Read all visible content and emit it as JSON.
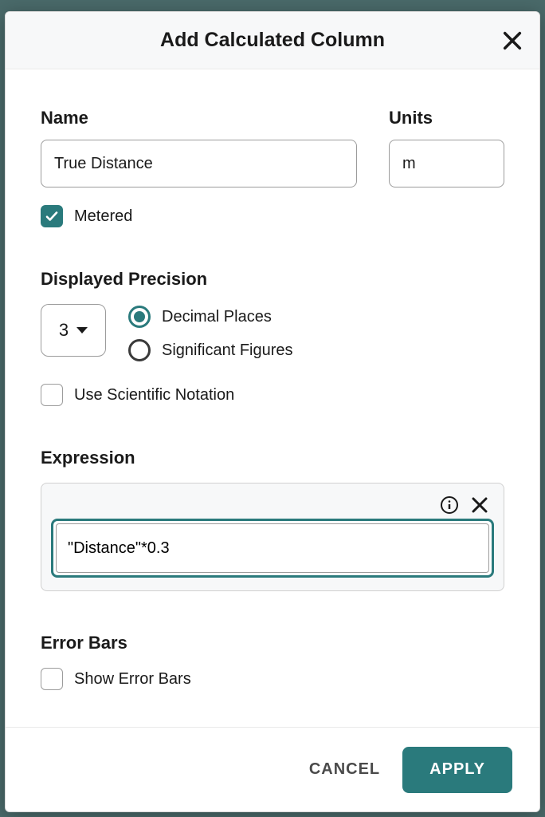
{
  "modal": {
    "title": "Add Calculated Column",
    "name_label": "Name",
    "name_value": "True Distance",
    "units_label": "Units",
    "units_value": "m",
    "metered_label": "Metered",
    "metered_checked": true
  },
  "precision": {
    "heading": "Displayed Precision",
    "value": "3",
    "options": {
      "decimal": "Decimal Places",
      "sigfig": "Significant Figures"
    },
    "selected": "decimal",
    "scientific_label": "Use Scientific Notation",
    "scientific_checked": false
  },
  "expression": {
    "heading": "Expression",
    "value": "\"Distance\"*0.3"
  },
  "errorbars": {
    "heading": "Error Bars",
    "show_label": "Show Error Bars",
    "show_checked": false
  },
  "footer": {
    "cancel": "CANCEL",
    "apply": "APPLY"
  }
}
